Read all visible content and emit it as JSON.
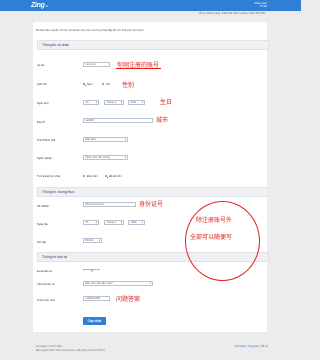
{
  "header": {
    "logo_text": "Zing",
    "logo_sub": "ID",
    "user_line1": "Chào bạn!",
    "user_line2": "Thoát"
  },
  "hotline": {
    "text": "Hỗ trợ khách hàng: 1900 561 558 | Hotline: 0934 545 555"
  },
  "intro": "Để bảo đảm quyền sở hữu tài khoản này, bạn vui lòng nhập đầy đủ các thông tin bên dưới.",
  "section_personal": {
    "title": "Thông tin cá nhân",
    "fullname_label": "Họ tên",
    "fullname_value": "xxxxxxxx",
    "gender_label": "Giới tính",
    "gender_male": "Nam",
    "gender_female": "Nữ",
    "dob_label": "Ngày sinh",
    "dob_day": "19",
    "dob_month": "Tháng 4",
    "dob_year": "2011",
    "address_label": "Địa chỉ",
    "address_value": "asdfsdf",
    "city_label": "Tỉnh/Thành phố",
    "city_value": "Bắc Ninh",
    "job_label": "Nghề nghiệp",
    "job_value": "Nhân viên văn phòng",
    "marital_label": "Tình trạng hôn nhân",
    "marital_single": "Độc thân",
    "marital_married": "Đã kết hôn"
  },
  "section_id": {
    "title": "Thông tin chứng thực",
    "idnum_label": "Số CMND",
    "idnum_value": "dfsvnnsvnnsvnn",
    "issue_label": "Ngày cấp",
    "issue_day": "15",
    "issue_month": "Tháng 2",
    "issue_year": "1990",
    "place_label": "Nơi cấp",
    "place_value": "Bà Rịa"
  },
  "section_security": {
    "title": "Thông tin bảo vệ",
    "email_label": "Email bảo vệ",
    "email_value": "f*******@***.***",
    "question_label": "Câu hỏi bảo vệ",
    "question_value": "Bạn sinh vào năm nào?",
    "answer_label": "Trả lời (Ẩn nhé)",
    "answer_value": "adsfdsfsdfsd"
  },
  "submit_label": "Cập nhật",
  "annotations": {
    "account": "你刚注册的账号",
    "gender": "性别",
    "birthday": "生日",
    "city": "城市",
    "id_card": "身份证号",
    "answer": "问题答案",
    "oval_line1": "除注册账号外",
    "oval_line2": "全部可以随便写"
  },
  "footer": {
    "line1": "Copyright © 2013 VNG",
    "line2": "Bản quyền thuộc VNG Corporation, Giấy phép số 43 với MXH",
    "links": "Giới thiệu | Trung tâm | Hỗ trợ"
  },
  "colors": {
    "accent": "#2f7fd6",
    "annotation_red": "#e0201c"
  }
}
